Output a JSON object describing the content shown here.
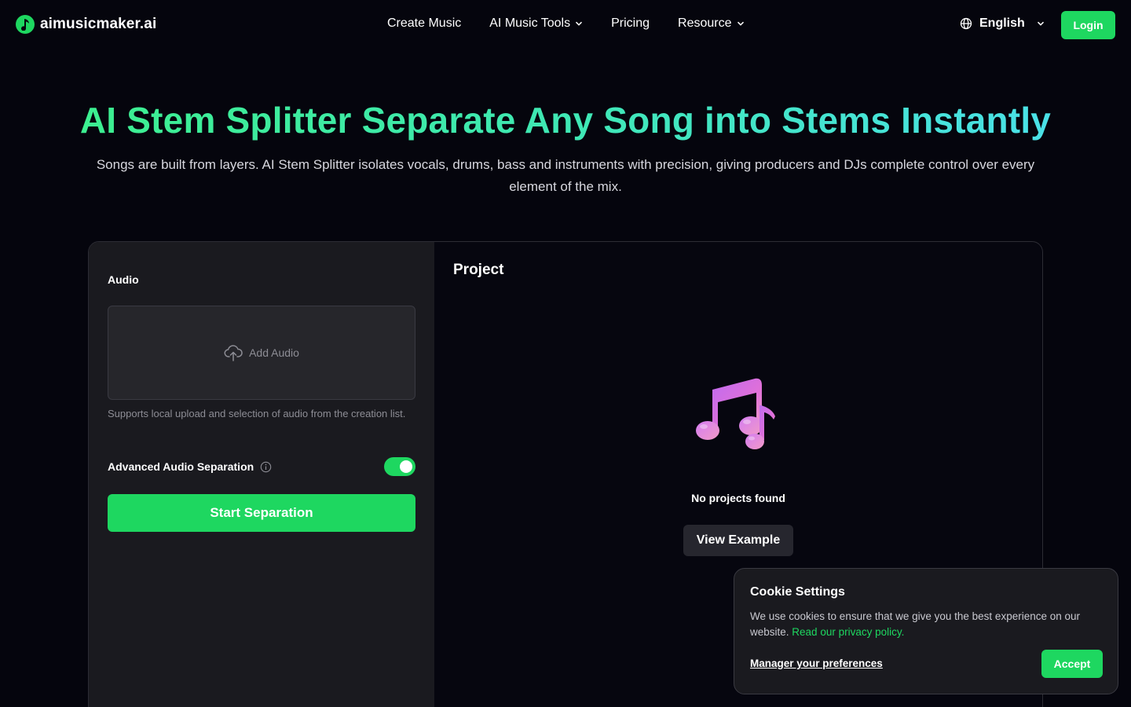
{
  "header": {
    "logo_text": "aimusicmaker.ai",
    "logo_icon": "music-note-icon",
    "nav": [
      {
        "label": "Create Music",
        "dropdown": false
      },
      {
        "label": "AI Music Tools",
        "dropdown": true
      },
      {
        "label": "Pricing",
        "dropdown": false
      },
      {
        "label": "Resource",
        "dropdown": true
      }
    ],
    "language": "English",
    "login_label": "Login"
  },
  "hero": {
    "title": "AI Stem Splitter Separate Any Song into Stems Instantly",
    "subtitle": "Songs are built from layers. AI Stem Splitter isolates vocals, drums, bass and instruments with precision, giving producers and DJs complete control over every element of the mix."
  },
  "audio_panel": {
    "label": "Audio",
    "add_audio": "Add Audio",
    "help_text": "Supports local upload and selection of audio from the creation list.",
    "advanced_label": "Advanced Audio Separation",
    "advanced_enabled": true,
    "start_label": "Start Separation"
  },
  "project_panel": {
    "title": "Project",
    "empty_text": "No projects found",
    "view_example": "View Example"
  },
  "cookie": {
    "title": "Cookie Settings",
    "text": "We use cookies to ensure that we give you the best experience on our website.",
    "link_text": "Read our privacy policy.",
    "preferences": "Manager your preferences",
    "accept": "Accept"
  },
  "colors": {
    "brand_green": "#1ed760",
    "background": "#05050d",
    "panel_left": "#1a1a1f"
  }
}
